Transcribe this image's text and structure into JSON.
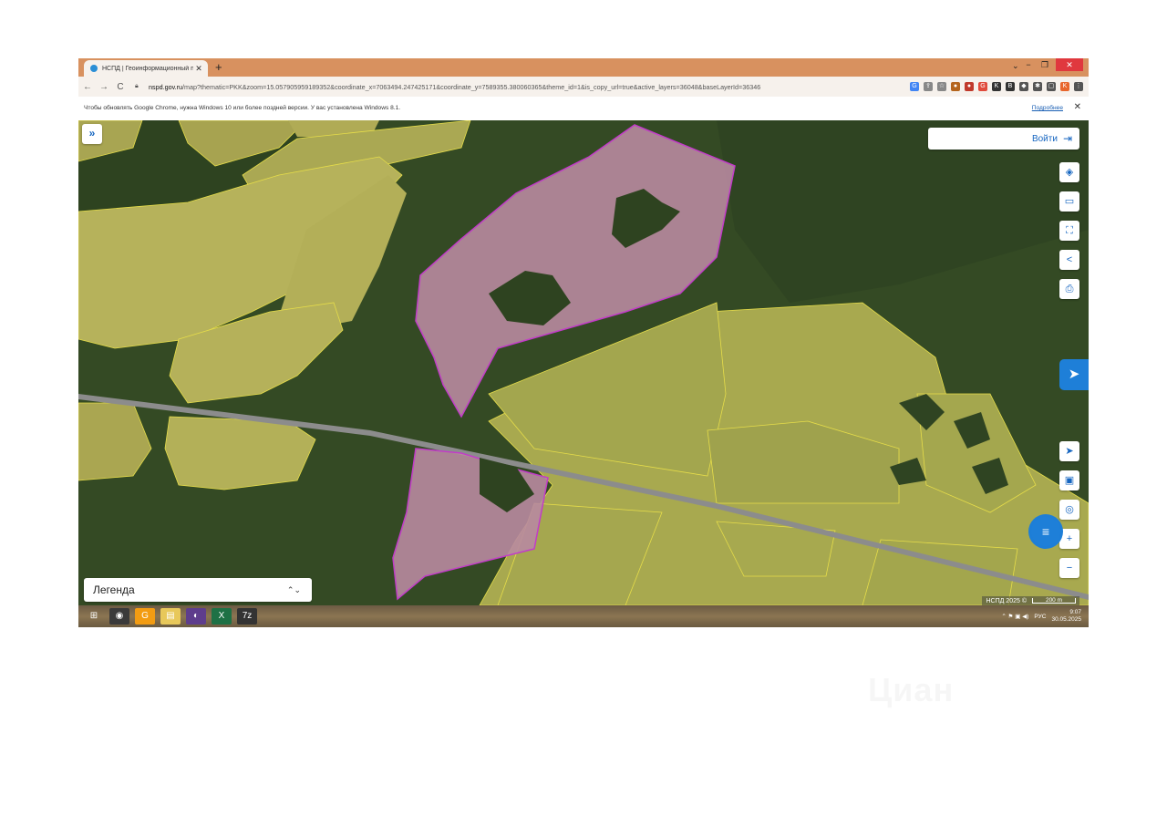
{
  "browser": {
    "tab_title": "НСПД | Геоинформационный п",
    "tab_close": "✕",
    "new_tab": "+",
    "tab_search": "⌄",
    "win_min": "−",
    "win_max": "❐",
    "win_close": "✕",
    "back": "←",
    "forward": "→",
    "reload": "C",
    "url_host": "nspd.gov.ru",
    "url_rest": "/map?thematic=PKK&zoom=15.057905959189352&coordinate_x=7063494.247425171&coordinate_y=7589355.380060365&theme_id=1&is_copy_url=true&active_layers=36048&baseLayerId=36346",
    "extensions": [
      {
        "glyph": "G",
        "color": "#4285f4"
      },
      {
        "glyph": "⇪",
        "color": "#888888"
      },
      {
        "glyph": "☆",
        "color": "#888888"
      },
      {
        "glyph": "●",
        "color": "#b5651d"
      },
      {
        "glyph": "●",
        "color": "#c0392b"
      },
      {
        "glyph": "G",
        "color": "#e04b3c"
      },
      {
        "glyph": "K",
        "color": "#333333"
      },
      {
        "glyph": "B",
        "color": "#333333"
      },
      {
        "glyph": "◆",
        "color": "#555555"
      },
      {
        "glyph": "✱",
        "color": "#555555"
      },
      {
        "glyph": "▢",
        "color": "#555555"
      },
      {
        "glyph": "K",
        "color": "#e8662c"
      },
      {
        "glyph": "⋮",
        "color": "#555555"
      }
    ]
  },
  "infobar": {
    "text": "Чтобы обновлять Google Chrome, нужна Windows 10 или более поздней версии. У вас установлена Windows 8.1.",
    "link": "Подробнее",
    "close": "✕"
  },
  "map": {
    "expand": "»",
    "login_label": "Войти",
    "login_icon": "⇥",
    "tools": [
      {
        "name": "layers-icon",
        "glyph": "◈"
      },
      {
        "name": "ruler-icon",
        "glyph": "▭"
      },
      {
        "name": "select-area-icon",
        "glyph": "⛶"
      },
      {
        "name": "share-icon",
        "glyph": "<"
      },
      {
        "name": "print-icon",
        "glyph": "⎙"
      }
    ],
    "side_tab": "➤",
    "nav_tools": [
      {
        "name": "locate-icon",
        "glyph": "➤"
      },
      {
        "name": "minimap-icon",
        "glyph": "▣"
      },
      {
        "name": "geolocation-icon",
        "glyph": "◎"
      },
      {
        "name": "zoom-in-icon",
        "glyph": "+"
      },
      {
        "name": "zoom-out-icon",
        "glyph": "−"
      }
    ],
    "chat": "≡",
    "legend_label": "Легенда",
    "legend_arrows": "⌃⌄",
    "copyright": "НСПД 2025 ©",
    "scale": "200 m",
    "colors": {
      "forest": "#344a24",
      "field": "#b8b35c",
      "field_alt": "#9fa24e",
      "parcel_fill": "#b889a0",
      "parcel_stroke": "#c23cc8",
      "road": "#8c8c8c",
      "boundary": "#e6dd4a"
    }
  },
  "taskbar": {
    "apps": [
      {
        "name": "start-icon",
        "glyph": "⊞",
        "color": "transparent"
      },
      {
        "name": "chrome-icon",
        "glyph": "◉",
        "color": "#3a3a3a"
      },
      {
        "name": "orange-app-icon",
        "glyph": "G",
        "color": "#f39c12"
      },
      {
        "name": "folder-icon",
        "glyph": "▤",
        "color": "#e8c85a"
      },
      {
        "name": "browser-app-icon",
        "glyph": "◐",
        "color": "#5e3d8c"
      },
      {
        "name": "excel-icon",
        "glyph": "X",
        "color": "#1e7145"
      },
      {
        "name": "7zip-icon",
        "glyph": "7z",
        "color": "#333333"
      }
    ],
    "tray_icons": "⌃ ⚑ ▣ ◀)",
    "lang": "РУС",
    "time": "9:07",
    "date": "30.05.2025"
  },
  "watermark": "Циан"
}
